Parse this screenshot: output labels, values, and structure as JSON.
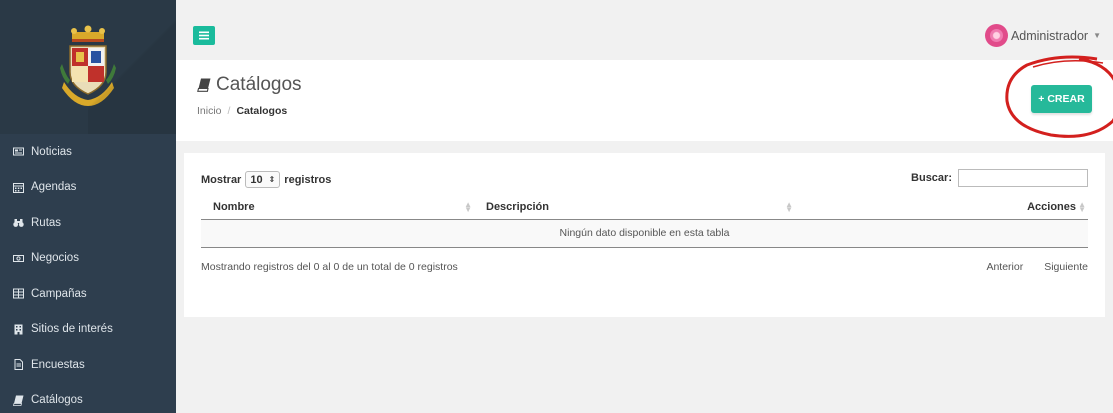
{
  "sidebar": {
    "items": [
      {
        "label": "Noticias",
        "icon": "newspaper-icon"
      },
      {
        "label": "Agendas",
        "icon": "calendar-icon"
      },
      {
        "label": "Rutas",
        "icon": "binoculars-icon"
      },
      {
        "label": "Negocios",
        "icon": "money-icon"
      },
      {
        "label": "Campañas",
        "icon": "grid-icon"
      },
      {
        "label": "Sitios de interés",
        "icon": "building-icon"
      },
      {
        "label": "Encuestas",
        "icon": "file-icon"
      },
      {
        "label": "Catálogos",
        "icon": "book-icon"
      }
    ]
  },
  "topbar": {
    "user_name": "Administrador"
  },
  "header": {
    "title": "Catálogos",
    "breadcrumb": {
      "home": "Inicio",
      "sep": "/",
      "current": "Catalogos"
    },
    "create_label": "+ CREAR"
  },
  "table_controls": {
    "show_prefix": "Mostrar",
    "page_size": "10",
    "show_suffix": "registros",
    "search_label": "Buscar:",
    "search_value": ""
  },
  "table": {
    "columns": [
      "Nombre",
      "Descripción",
      "Acciones"
    ],
    "empty_message": "Ningún dato disponible en esta tabla"
  },
  "footer": {
    "info": "Mostrando registros del 0 al 0 de un total de 0 registros",
    "prev": "Anterior",
    "next": "Siguiente"
  },
  "colors": {
    "accent": "#26b99a",
    "sidebar": "#2e3e4e",
    "annotation": "#d3201e"
  }
}
